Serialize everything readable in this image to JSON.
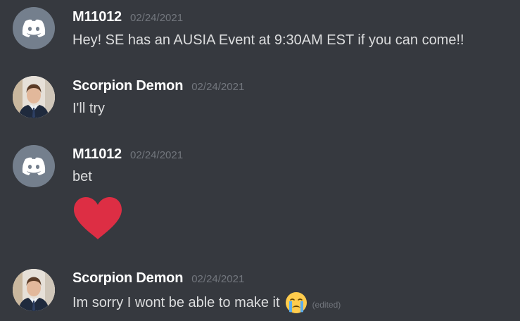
{
  "messages": [
    {
      "username": "M11012",
      "timestamp": "02/24/2021",
      "text": "Hey! SE has an AUSIA Event at 9:30AM EST if you can come!!",
      "avatar": "discord-logo-icon"
    },
    {
      "username": "Scorpion Demon",
      "timestamp": "02/24/2021",
      "text": "I'll try",
      "avatar": "profile-photo"
    },
    {
      "username": "M11012",
      "timestamp": "02/24/2021",
      "text": "bet",
      "avatar": "discord-logo-icon",
      "emoji": "heart-icon"
    },
    {
      "username": "Scorpion Demon",
      "timestamp": "02/24/2021",
      "text": "Im sorry I wont be able to make it",
      "edited_label": "(edited)",
      "avatar": "profile-photo",
      "emoji": "crying-face-icon"
    }
  ],
  "colors": {
    "background": "#36393f",
    "username": "#ffffff",
    "text": "#dcddde",
    "timestamp": "#72767d",
    "discord_avatar_bg": "#747f8d",
    "heart": "#dd2e44"
  }
}
